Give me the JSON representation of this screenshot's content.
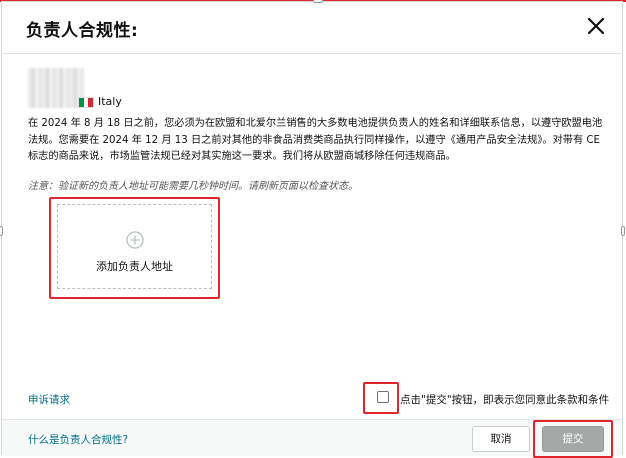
{
  "dialog": {
    "title": "负责人合规性:",
    "close_icon": "close-icon"
  },
  "seller": {
    "country": "Italy",
    "flag_colors": [
      "#009246",
      "#ffffff",
      "#ce2b37"
    ],
    "avatar": "blurred-seller-image"
  },
  "notice": {
    "text": "在 2024 年 8 月 18 日之前，您必须为在欧盟和北爱尔兰销售的大多数电池提供负责人的姓名和详细联系信息，以遵守欧盟电池法规。您需要在 2024 年 12 月 13 日之前对其他的非食品消费类商品执行同样操作，以遵守《通用产品安全法规》。对带有 CE 标志的商品来说，市场监管法规已经对其实施这一要求。我们将从欧盟商城移除任何违规商品。"
  },
  "note": {
    "text": "注意：验证新的负责人地址可能需要几秒钟时间。请刷新页面以检查状态。"
  },
  "add_card": {
    "icon": "plus-circle-icon",
    "label": "添加负责人地址"
  },
  "links": {
    "appeal": "申诉请求",
    "what_is": "什么是负责人合规性?"
  },
  "agreement": {
    "checked": false,
    "text": "点击\"提交\"按钮，即表示您同意此条款和条件"
  },
  "buttons": {
    "cancel": "取消",
    "submit": "提交"
  },
  "colors": {
    "highlight": "#e0262d",
    "link": "#007185",
    "submit_disabled": "#a6a8a8"
  }
}
